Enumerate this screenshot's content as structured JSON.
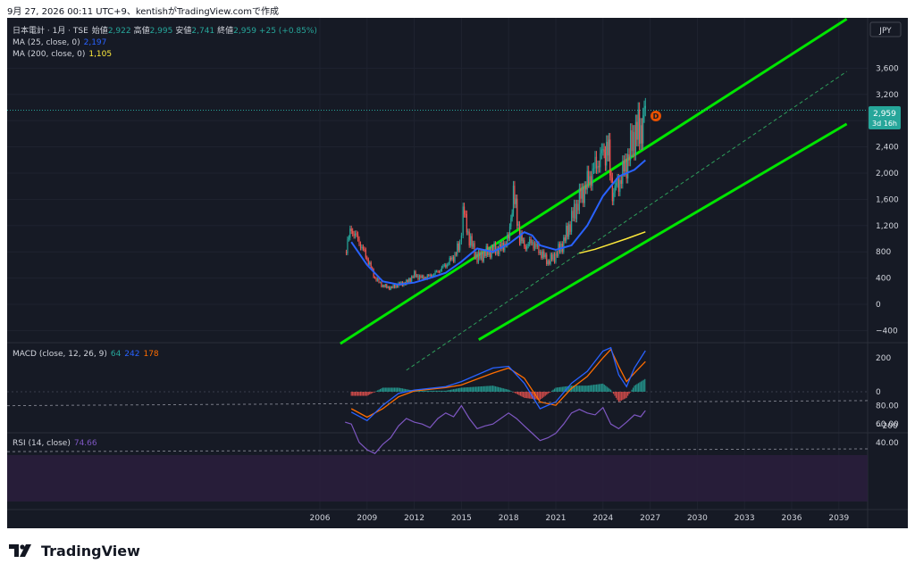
{
  "caption": "9月 27, 2026 00:11 UTC+9、kentishがTradingView.comで作成",
  "legend": {
    "title": "日本電計 · 1月 · TSE",
    "open_label": "始値",
    "open": "2,922",
    "high_label": "高値",
    "high": "2,995",
    "low_label": "安値",
    "low": "2,741",
    "close_label": "終値",
    "close": "2,959",
    "change": "+25 (+0.85%)",
    "ma25_label": "MA (25, close, 0)",
    "ma25_value": "2,197",
    "ma200_label": "MA (200, close, 0)",
    "ma200_value": "1,105"
  },
  "currency": "JPY",
  "price_label": {
    "value": "2,959",
    "countdown": "3d 16h"
  },
  "macd": {
    "label": "MACD (close, 12, 26, 9)",
    "hist": "64",
    "macd": "242",
    "signal": "178"
  },
  "rsi": {
    "label": "RSI (14, close)",
    "value": "74.66"
  },
  "marker": "D",
  "brand": "TradingView",
  "colors": {
    "up": "#26a69a",
    "down": "#ef5350",
    "ma25": "#2962ff",
    "ma200": "#ffeb3b",
    "channel": "#00e600",
    "macd_line": "#2962ff",
    "signal_line": "#ff6d00",
    "rsi_line": "#7e57c2",
    "background": "#161a25"
  },
  "chart_data": [
    {
      "type": "line",
      "title": "日本電計 · 1月 · TSE",
      "x_ticks": [
        "2006",
        "2009",
        "2012",
        "2015",
        "2018",
        "2021",
        "2024",
        "2027",
        "2030",
        "2033",
        "2036",
        "2039"
      ],
      "y_ticks": [
        "3,600",
        "3,200",
        "2,800",
        "2,400",
        "2,000",
        "1,600",
        "1,200",
        "800",
        "400",
        "0",
        "−400"
      ],
      "ylim": [
        -540,
        4000
      ],
      "series": [
        {
          "name": "Price (monthly close)",
          "x": [
            2007.6,
            2008.0,
            2008.5,
            2009.0,
            2009.5,
            2010.0,
            2010.5,
            2011.0,
            2011.5,
            2012.0,
            2012.5,
            2013.0,
            2013.5,
            2014.0,
            2014.5,
            2014.9,
            2015.1,
            2015.5,
            2016.0,
            2016.5,
            2017.0,
            2017.5,
            2018.0,
            2018.3,
            2018.7,
            2019.0,
            2019.5,
            2020.0,
            2020.5,
            2021.0,
            2021.5,
            2022.0,
            2022.5,
            2023.0,
            2023.5,
            2024.0,
            2024.3,
            2024.6,
            2025.0,
            2025.5,
            2026.0,
            2026.4,
            2026.7
          ],
          "values": [
            800,
            1150,
            950,
            700,
            400,
            280,
            250,
            300,
            330,
            450,
            400,
            430,
            500,
            600,
            720,
            900,
            1450,
            1000,
            700,
            780,
            830,
            850,
            1000,
            1700,
            1050,
            880,
            950,
            800,
            650,
            750,
            950,
            1300,
            1600,
            1850,
            2100,
            2300,
            2400,
            1700,
            1850,
            2150,
            2600,
            2650,
            2959
          ]
        },
        {
          "name": "MA (25, close, 0)",
          "x": [
            2008.0,
            2009.0,
            2010.0,
            2011.0,
            2012.0,
            2013.0,
            2014.0,
            2015.0,
            2016.0,
            2017.0,
            2018.0,
            2019.0,
            2019.5,
            2020.0,
            2021.0,
            2022.0,
            2023.0,
            2024.0,
            2025.0,
            2026.0,
            2026.7
          ],
          "values": [
            950,
            600,
            350,
            300,
            330,
            400,
            480,
            650,
            850,
            800,
            920,
            1100,
            1050,
            900,
            830,
            900,
            1200,
            1650,
            1950,
            2050,
            2197
          ]
        },
        {
          "name": "MA (200, close, 0)",
          "x": [
            2022.5,
            2023.5,
            2024.5,
            2025.5,
            2026.7
          ],
          "values": [
            780,
            840,
            920,
            1000,
            1105
          ]
        },
        {
          "name": "Channel upper",
          "x": [
            2006.0,
            2039.5
          ],
          "values": [
            -1100,
            4350
          ]
        },
        {
          "name": "Channel lower",
          "x": [
            2006.0,
            2039.5
          ],
          "values": [
            -2700,
            2750
          ]
        }
      ]
    },
    {
      "type": "line",
      "title": "MACD (close, 12, 26, 9)",
      "y_ticks": [
        "200",
        "0",
        "−200"
      ],
      "series": [
        {
          "name": "MACD",
          "x": [
            2008.0,
            2009.0,
            2010.0,
            2011.0,
            2012.0,
            2014.0,
            2015.0,
            2017.0,
            2018.0,
            2019.0,
            2020.0,
            2021.0,
            2022.0,
            2023.0,
            2024.0,
            2024.5,
            2025.0,
            2025.5,
            2026.0,
            2026.7
          ],
          "values": [
            -120,
            -170,
            -80,
            -10,
            10,
            30,
            60,
            140,
            150,
            50,
            -100,
            -60,
            50,
            120,
            240,
            260,
            100,
            30,
            140,
            242
          ]
        },
        {
          "name": "Signal",
          "x": [
            2008.0,
            2009.0,
            2010.0,
            2011.0,
            2012.0,
            2014.0,
            2015.0,
            2017.0,
            2018.0,
            2019.0,
            2020.0,
            2021.0,
            2022.0,
            2023.0,
            2024.0,
            2024.5,
            2025.0,
            2025.5,
            2026.0,
            2026.7
          ],
          "values": [
            -100,
            -150,
            -100,
            -30,
            5,
            25,
            40,
            110,
            140,
            80,
            -60,
            -80,
            20,
            90,
            200,
            250,
            150,
            60,
            110,
            178
          ]
        }
      ]
    },
    {
      "type": "line",
      "title": "RSI (14, close)",
      "y_ticks": [
        "80.00",
        "60.00",
        "40.00"
      ],
      "ylim": [
        25,
        92
      ],
      "series": [
        {
          "name": "RSI",
          "x": [
            2007.6,
            2008.0,
            2008.5,
            2009.0,
            2009.5,
            2010.0,
            2010.5,
            2011.0,
            2011.5,
            2012.0,
            2012.5,
            2013.0,
            2013.5,
            2014.0,
            2014.5,
            2015.0,
            2015.5,
            2016.0,
            2016.5,
            2017.0,
            2017.5,
            2018.0,
            2018.5,
            2019.0,
            2019.5,
            2020.0,
            2020.5,
            2021.0,
            2021.5,
            2022.0,
            2022.5,
            2023.0,
            2023.5,
            2024.0,
            2024.5,
            2025.0,
            2025.5,
            2026.0,
            2026.4,
            2026.7
          ],
          "values": [
            62,
            60,
            40,
            32,
            28,
            38,
            45,
            58,
            66,
            62,
            60,
            56,
            66,
            72,
            68,
            80,
            66,
            55,
            58,
            60,
            66,
            72,
            66,
            58,
            50,
            42,
            45,
            50,
            60,
            72,
            76,
            72,
            70,
            78,
            60,
            55,
            62,
            70,
            68,
            74.66
          ]
        }
      ]
    }
  ]
}
